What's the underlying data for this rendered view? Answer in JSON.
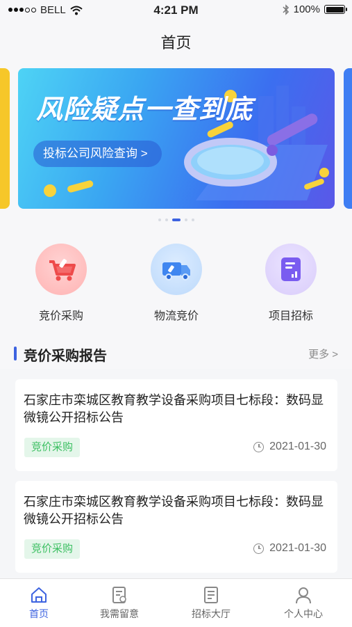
{
  "status_bar": {
    "carrier": "BELL",
    "time": "4:21 PM",
    "battery": "100%",
    "battery_level": 1.0
  },
  "header": {
    "title": "首页"
  },
  "banner": {
    "title": "风险疑点一查到底",
    "button_label": "投标公司风险查询 >",
    "page_count": 5,
    "active_page": 2
  },
  "categories": [
    {
      "label": "竞价采购",
      "icon": "shopping-cart-icon",
      "color": "#f06a6a"
    },
    {
      "label": "物流竞价",
      "icon": "truck-icon",
      "color": "#3f86f0"
    },
    {
      "label": "项目招标",
      "icon": "document-chart-icon",
      "color": "#7a5cf0"
    }
  ],
  "section": {
    "title": "竞价采购报告",
    "more_label": "更多 >"
  },
  "reports": [
    {
      "title": "石家庄市栾城区教育教学设备采购项目七标段：数码显微镜公开招标公告",
      "tag": "竞价采购",
      "date": "2021-01-30"
    },
    {
      "title": "石家庄市栾城区教育教学设备采购项目七标段：数码显微镜公开招标公告",
      "tag": "竞价采购",
      "date": "2021-01-30"
    }
  ],
  "tabbar": {
    "items": [
      {
        "label": "首页",
        "icon": "home-icon",
        "active": true
      },
      {
        "label": "我需留意",
        "icon": "notice-icon",
        "active": false
      },
      {
        "label": "招标大厅",
        "icon": "bidding-hall-icon",
        "active": false
      },
      {
        "label": "个人中心",
        "icon": "user-icon",
        "active": false
      }
    ]
  },
  "colors": {
    "accent": "#3d63e0",
    "tag_green": "#3bbf61"
  }
}
